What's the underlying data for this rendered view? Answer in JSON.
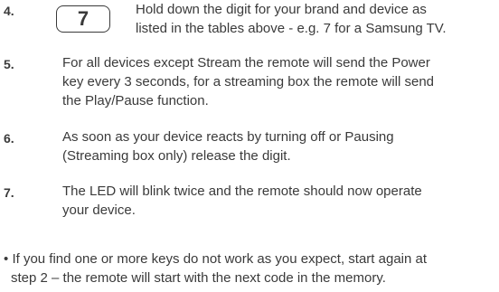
{
  "steps": [
    {
      "number": "4.",
      "key_label": "7",
      "text_lines": [
        "Hold down the digit for your brand and device as",
        "listed in the tables above - e.g. 7  for a Samsung TV."
      ]
    },
    {
      "number": "5.",
      "text_lines": [
        "For all devices except Stream the remote will send the Power",
        "key every 3 seconds,  for a streaming box the remote will send",
        "the Play/Pause function."
      ]
    },
    {
      "number": "6.",
      "text_lines": [
        "As soon as your device reacts by turning off or Pausing",
        "(Streaming box only) release the digit."
      ]
    },
    {
      "number": "7.",
      "text_lines": [
        "The LED will blink twice and the remote should now operate",
        "your device."
      ]
    }
  ],
  "note": {
    "bullet": "•",
    "line1": "If you find one or more keys do not work as you expect, start again at",
    "line2": "step 2 – the remote will start with the next code in the memory."
  }
}
